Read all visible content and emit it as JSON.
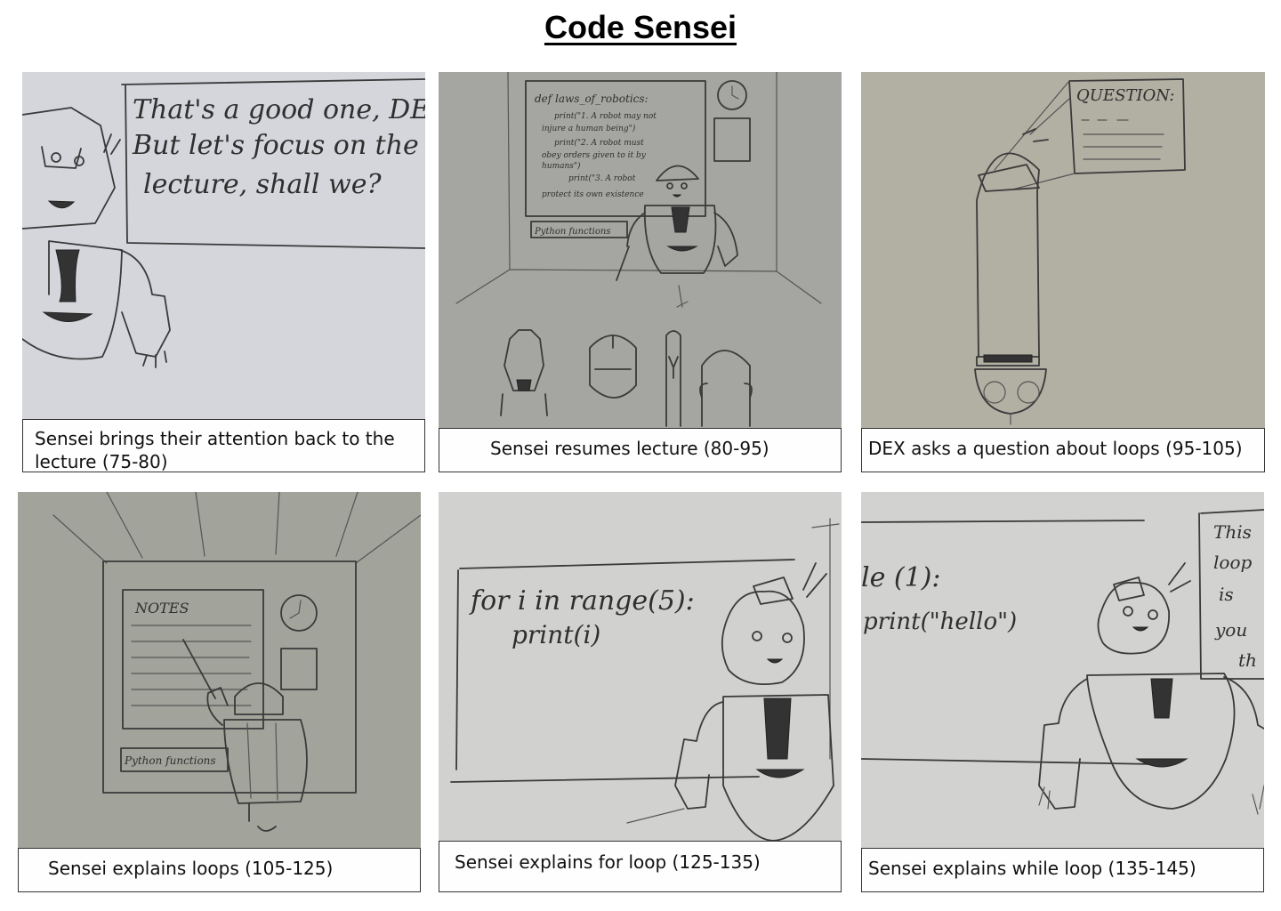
{
  "title": "Code Sensei",
  "panels": [
    {
      "caption": "Sensei brings their attention back to the lecture (75-80)",
      "board_text": [
        "That's a good one, DEX,",
        "But let's focus on the",
        "lecture, shall we?"
      ]
    },
    {
      "caption": "Sensei resumes lecture (80-95)",
      "board_text": [
        "def laws_of_robotics:",
        "print(\"1. A robot may not",
        "injure a human being\")",
        "print(\"2. A robot must",
        "obey orders given to it by",
        "humans\")",
        "print(\"3. A robot",
        "protect its own existence"
      ],
      "board_label": "Python functions"
    },
    {
      "caption": "DEX asks a question about loops (95-105)",
      "board_text": [
        "QUESTION:"
      ]
    },
    {
      "caption": "Sensei explains loops  (105-125)",
      "board_text": [
        "NOTES"
      ],
      "board_label": "Python functions"
    },
    {
      "caption": "Sensei explains for loop (125-135)",
      "board_text": [
        "for i in range(5):",
        "print(i)"
      ]
    },
    {
      "caption": "Sensei explains while loop  (135-145)",
      "board_text": [
        "le (1):",
        "print(\"hello\")",
        "This",
        "loop",
        "is",
        "you",
        "th"
      ]
    }
  ]
}
